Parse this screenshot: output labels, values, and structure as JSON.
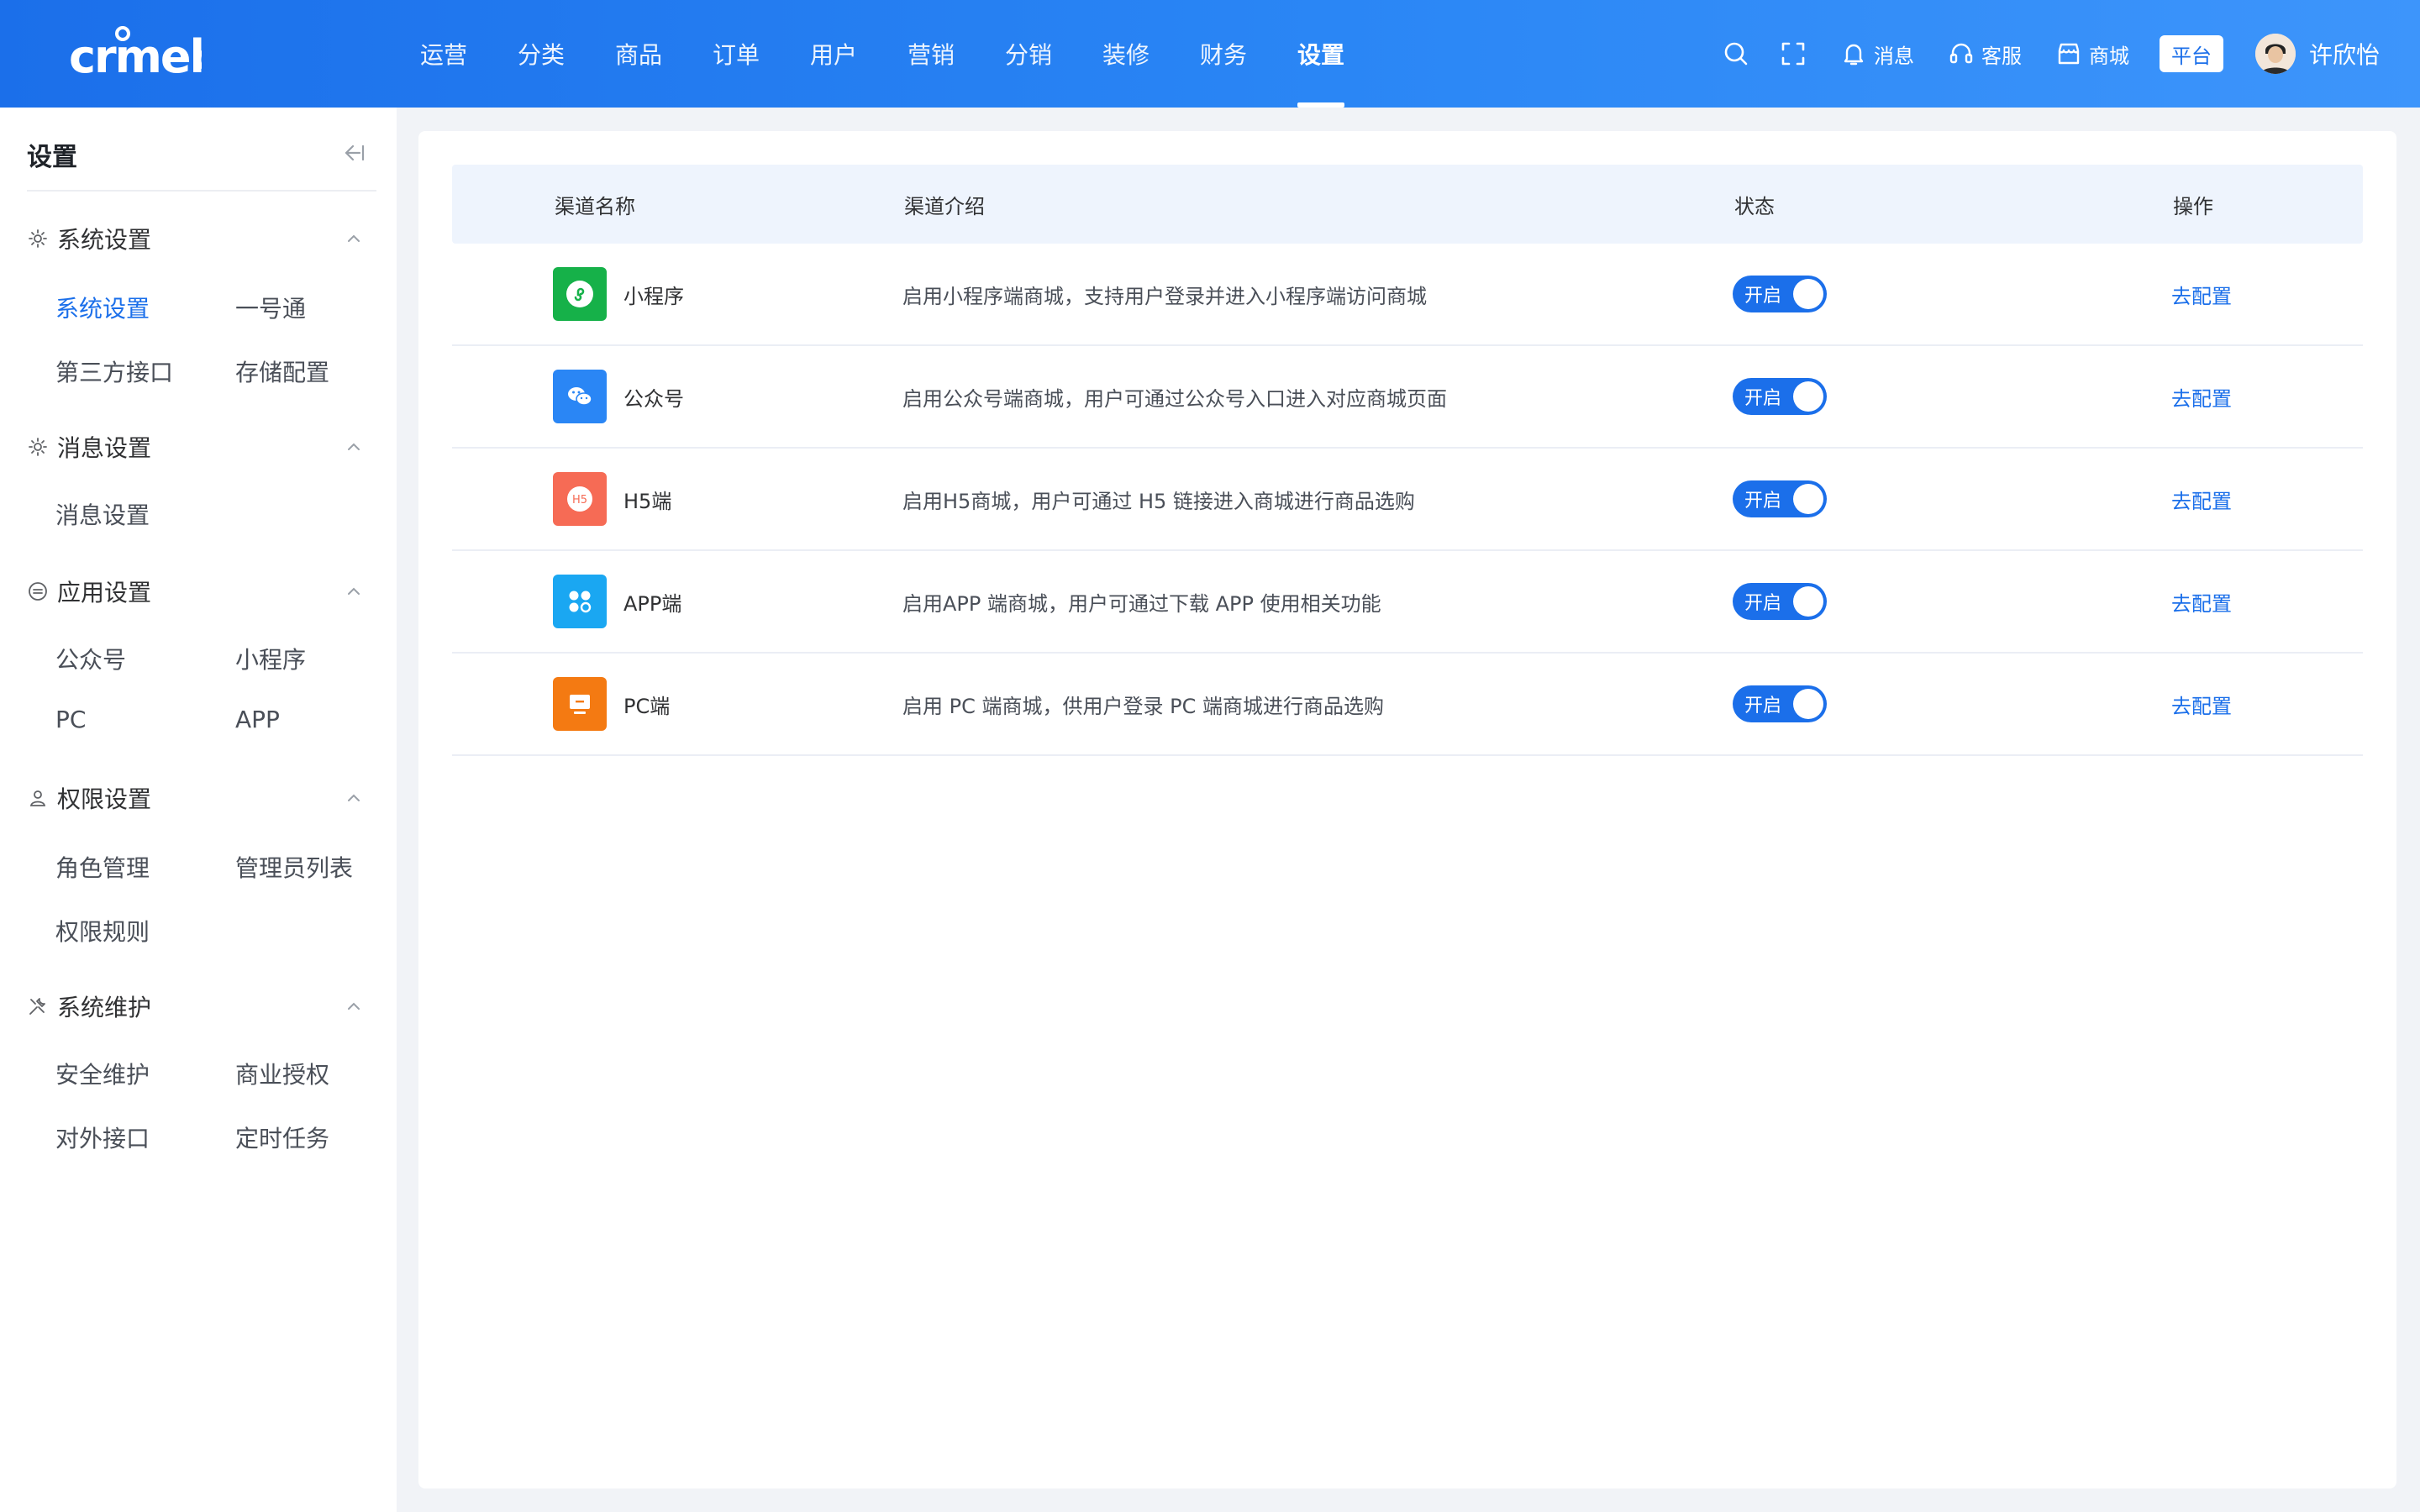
{
  "brand": {
    "logo_text": "crmeb"
  },
  "nav": {
    "items": [
      {
        "label": "运营"
      },
      {
        "label": "分类"
      },
      {
        "label": "商品"
      },
      {
        "label": "订单"
      },
      {
        "label": "用户"
      },
      {
        "label": "营销"
      },
      {
        "label": "分销"
      },
      {
        "label": "装修"
      },
      {
        "label": "财务"
      },
      {
        "label": "设置"
      }
    ],
    "active": "设置"
  },
  "header_actions": {
    "message_label": "消息",
    "service_label": "客服",
    "mall_label": "商城",
    "platform_label": "平台",
    "user_name": "许欣怡"
  },
  "sidebar": {
    "title": "设置",
    "groups": [
      {
        "title": "系统设置",
        "icon": "gear-icon",
        "items": [
          "系统设置",
          "一号通",
          "第三方接口",
          "存储配置"
        ]
      },
      {
        "title": "消息设置",
        "icon": "gear-icon",
        "items": [
          "消息设置"
        ]
      },
      {
        "title": "应用设置",
        "icon": "app-icon",
        "items": [
          "公众号",
          "小程序",
          "PC",
          "APP"
        ]
      },
      {
        "title": "权限设置",
        "icon": "user-icon",
        "items": [
          "角色管理",
          "管理员列表",
          "权限规则"
        ]
      },
      {
        "title": "系统维护",
        "icon": "tools-icon",
        "items": [
          "安全维护",
          "商业授权",
          "对外接口",
          "定时任务"
        ]
      }
    ],
    "active_item": "系统设置"
  },
  "table": {
    "headers": {
      "name": "渠道名称",
      "desc": "渠道介绍",
      "status": "状态",
      "op": "操作"
    },
    "rows": [
      {
        "name": "小程序",
        "icon": "miniprogram-icon",
        "color": "#16b149",
        "desc": "启用小程序端商城，支持用户登录并进入小程序端访问商城",
        "status": "开启",
        "op": "去配置"
      },
      {
        "name": "公众号",
        "icon": "wechat-icon",
        "color": "#2a86f5",
        "desc": "启用公众号端商城，用户可通过公众号入口进入对应商城页面",
        "status": "开启",
        "op": "去配置"
      },
      {
        "name": "H5端",
        "icon": "h5-icon",
        "color": "#f66b55",
        "desc": "启用H5商城，用户可通过 H5 链接进入商城进行商品选购",
        "status": "开启",
        "op": "去配置"
      },
      {
        "name": "APP端",
        "icon": "app-grid-icon",
        "color": "#1aa7f2",
        "desc": "启用APP 端商城，用户可通过下载 APP 使用相关功能",
        "status": "开启",
        "op": "去配置"
      },
      {
        "name": "PC端",
        "icon": "monitor-icon",
        "color": "#f47a12",
        "desc": "启用 PC 端商城，供用户登录 PC 端商城进行商品选购",
        "status": "开启",
        "op": "去配置"
      }
    ]
  },
  "colors": {
    "primary": "#1b6fea",
    "header_start": "#1b6fea",
    "header_end": "#3d95fb"
  }
}
